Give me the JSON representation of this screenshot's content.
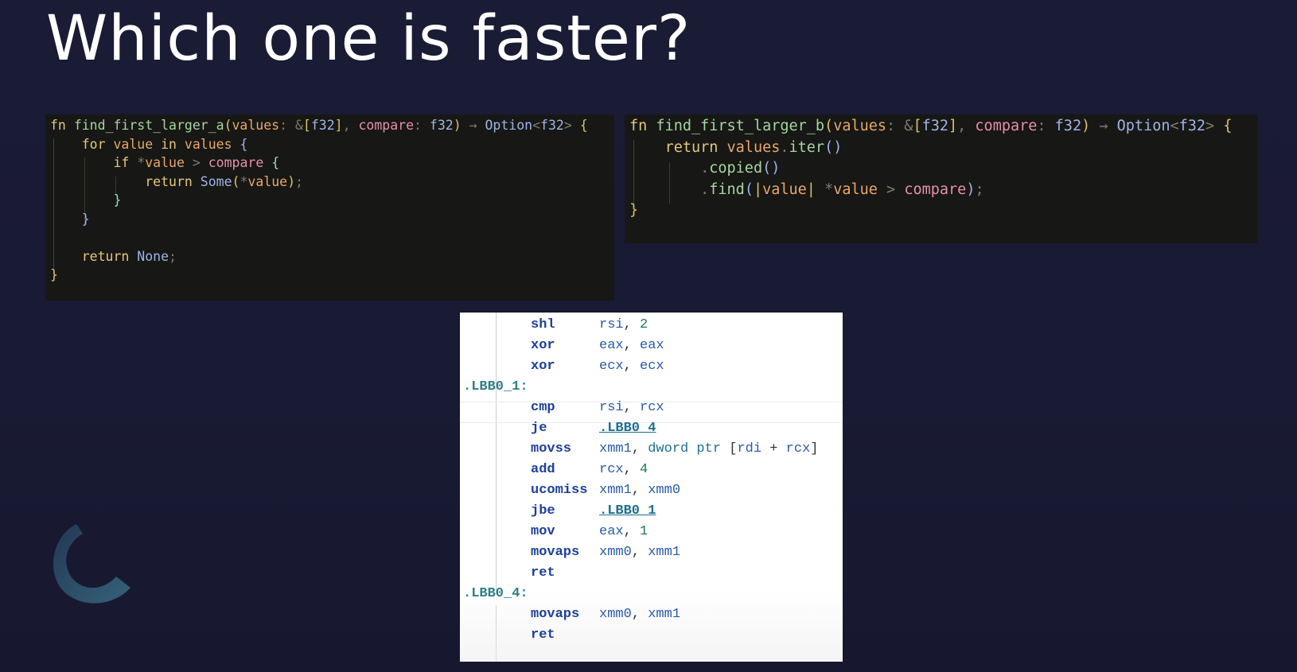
{
  "slide": {
    "title": "Which one is faster?"
  },
  "code_a": {
    "lines": [
      [
        [
          "kw",
          "fn"
        ],
        [
          "pn",
          " "
        ],
        [
          "fn",
          "find_first_larger_a"
        ],
        [
          "cl",
          "("
        ],
        [
          "id",
          "values"
        ],
        [
          "pn",
          ": &"
        ],
        [
          "cl",
          "["
        ],
        [
          "ty",
          "f32"
        ],
        [
          "cl",
          "]"
        ],
        [
          "pn",
          ", "
        ],
        [
          "pr",
          "compare"
        ],
        [
          "pn",
          ": "
        ],
        [
          "ty",
          "f32"
        ],
        [
          "cl",
          ")"
        ],
        [
          "pn",
          " → "
        ],
        [
          "ty",
          "Option"
        ],
        [
          "pn",
          "<"
        ],
        [
          "ty",
          "f32"
        ],
        [
          "pn",
          "> "
        ],
        [
          "cl",
          "{"
        ]
      ],
      [
        [
          "pn",
          "    "
        ],
        [
          "kw",
          "for"
        ],
        [
          "pn",
          " "
        ],
        [
          "id",
          "value"
        ],
        [
          "pn",
          " "
        ],
        [
          "kw",
          "in"
        ],
        [
          "pn",
          " "
        ],
        [
          "id",
          "values"
        ],
        [
          "pn",
          " "
        ],
        [
          "ty",
          "{"
        ]
      ],
      [
        [
          "pn",
          "        "
        ],
        [
          "kw",
          "if"
        ],
        [
          "pn",
          " *"
        ],
        [
          "id",
          "value"
        ],
        [
          "pn",
          " > "
        ],
        [
          "pr",
          "compare"
        ],
        [
          "pn",
          " "
        ],
        [
          "mac",
          "{"
        ]
      ],
      [
        [
          "pn",
          "            "
        ],
        [
          "kw",
          "return"
        ],
        [
          "pn",
          " "
        ],
        [
          "ty",
          "Some"
        ],
        [
          "cl",
          "("
        ],
        [
          "pn",
          "*"
        ],
        [
          "id",
          "value"
        ],
        [
          "cl",
          ")"
        ],
        [
          "pn",
          ";"
        ]
      ],
      [
        [
          "pn",
          "        "
        ],
        [
          "mac",
          "}"
        ]
      ],
      [
        [
          "pn",
          "    "
        ],
        [
          "ty",
          "}"
        ]
      ],
      [],
      [
        [
          "pn",
          "    "
        ],
        [
          "kw",
          "return"
        ],
        [
          "pn",
          " "
        ],
        [
          "ty",
          "None"
        ],
        [
          "pn",
          ";"
        ]
      ],
      [
        [
          "cl",
          "}"
        ]
      ]
    ]
  },
  "code_b": {
    "lines": [
      [
        [
          "kw",
          "fn"
        ],
        [
          "pn",
          " "
        ],
        [
          "fn",
          "find_first_larger_b"
        ],
        [
          "cl",
          "("
        ],
        [
          "id",
          "values"
        ],
        [
          "pn",
          ": &"
        ],
        [
          "cl",
          "["
        ],
        [
          "ty",
          "f32"
        ],
        [
          "cl",
          "]"
        ],
        [
          "pn",
          ", "
        ],
        [
          "pr",
          "compare"
        ],
        [
          "pn",
          ": "
        ],
        [
          "ty",
          "f32"
        ],
        [
          "cl",
          ")"
        ],
        [
          "pn",
          " → "
        ],
        [
          "ty",
          "Option"
        ],
        [
          "pn",
          "<"
        ],
        [
          "ty",
          "f32"
        ],
        [
          "pn",
          "> "
        ],
        [
          "cl",
          "{"
        ]
      ],
      [
        [
          "pn",
          "    "
        ],
        [
          "kw",
          "return"
        ],
        [
          "pn",
          " "
        ],
        [
          "id",
          "values"
        ],
        [
          "pn",
          "."
        ],
        [
          "fn",
          "iter"
        ],
        [
          "ty",
          "()"
        ]
      ],
      [
        [
          "pn",
          "        ."
        ],
        [
          "fn",
          "copied"
        ],
        [
          "ty",
          "()"
        ]
      ],
      [
        [
          "pn",
          "        ."
        ],
        [
          "fn",
          "find"
        ],
        [
          "ty",
          "("
        ],
        [
          "cl",
          "|"
        ],
        [
          "id",
          "value"
        ],
        [
          "cl",
          "|"
        ],
        [
          "pn",
          " *"
        ],
        [
          "id",
          "value"
        ],
        [
          "pn",
          " > "
        ],
        [
          "pr",
          "compare"
        ],
        [
          "ty",
          ")"
        ],
        [
          "pn",
          ";"
        ]
      ],
      [
        [
          "cl",
          "}"
        ]
      ]
    ]
  },
  "assembly": {
    "rows": [
      {
        "label": "",
        "op": "shl",
        "args": [
          [
            "reg",
            "rsi"
          ],
          [
            "punc",
            ", "
          ],
          [
            "num",
            "2"
          ]
        ]
      },
      {
        "label": "",
        "op": "xor",
        "args": [
          [
            "reg",
            "eax"
          ],
          [
            "punc",
            ", "
          ],
          [
            "reg",
            "eax"
          ]
        ]
      },
      {
        "label": "",
        "op": "xor",
        "args": [
          [
            "reg",
            "ecx"
          ],
          [
            "punc",
            ", "
          ],
          [
            "reg",
            "ecx"
          ]
        ]
      },
      {
        "label": ".LBB0_1:",
        "op": "",
        "args": []
      },
      {
        "label": "",
        "op": "cmp",
        "args": [
          [
            "reg",
            "rsi"
          ],
          [
            "punc",
            ", "
          ],
          [
            "reg",
            "rcx"
          ]
        ]
      },
      {
        "label": "",
        "op": "je",
        "args": [
          [
            "lnk",
            ".LBB0_4"
          ]
        ]
      },
      {
        "label": "",
        "op": "movss",
        "args": [
          [
            "reg",
            "xmm1"
          ],
          [
            "punc",
            ", "
          ],
          [
            "kwd",
            "dword ptr"
          ],
          [
            "punc",
            " ["
          ],
          [
            "reg",
            "rdi"
          ],
          [
            "punc",
            " + "
          ],
          [
            "reg",
            "rcx"
          ],
          [
            "punc",
            "]"
          ]
        ]
      },
      {
        "label": "",
        "op": "add",
        "args": [
          [
            "reg",
            "rcx"
          ],
          [
            "punc",
            ", "
          ],
          [
            "num",
            "4"
          ]
        ]
      },
      {
        "label": "",
        "op": "ucomiss",
        "args": [
          [
            "reg",
            "xmm1"
          ],
          [
            "punc",
            ", "
          ],
          [
            "reg",
            "xmm0"
          ]
        ]
      },
      {
        "label": "",
        "op": "jbe",
        "args": [
          [
            "lnk",
            ".LBB0_1"
          ]
        ]
      },
      {
        "label": "",
        "op": "mov",
        "args": [
          [
            "reg",
            "eax"
          ],
          [
            "punc",
            ", "
          ],
          [
            "num",
            "1"
          ]
        ]
      },
      {
        "label": "",
        "op": "movaps",
        "args": [
          [
            "reg",
            "xmm0"
          ],
          [
            "punc",
            ", "
          ],
          [
            "reg",
            "xmm1"
          ]
        ]
      },
      {
        "label": "",
        "op": "ret",
        "args": []
      },
      {
        "label": ".LBB0_4:",
        "op": "",
        "args": []
      },
      {
        "label": "",
        "op": "movaps",
        "args": [
          [
            "reg",
            "xmm0"
          ],
          [
            "punc",
            ", "
          ],
          [
            "reg",
            "xmm1"
          ]
        ]
      },
      {
        "label": "",
        "op": "ret",
        "args": []
      }
    ]
  },
  "logo": {
    "icon": "crescent-logo-icon"
  },
  "colors": {
    "background": "#1a1b35",
    "code_background": "#171715",
    "asm_background": "#ffffff"
  }
}
